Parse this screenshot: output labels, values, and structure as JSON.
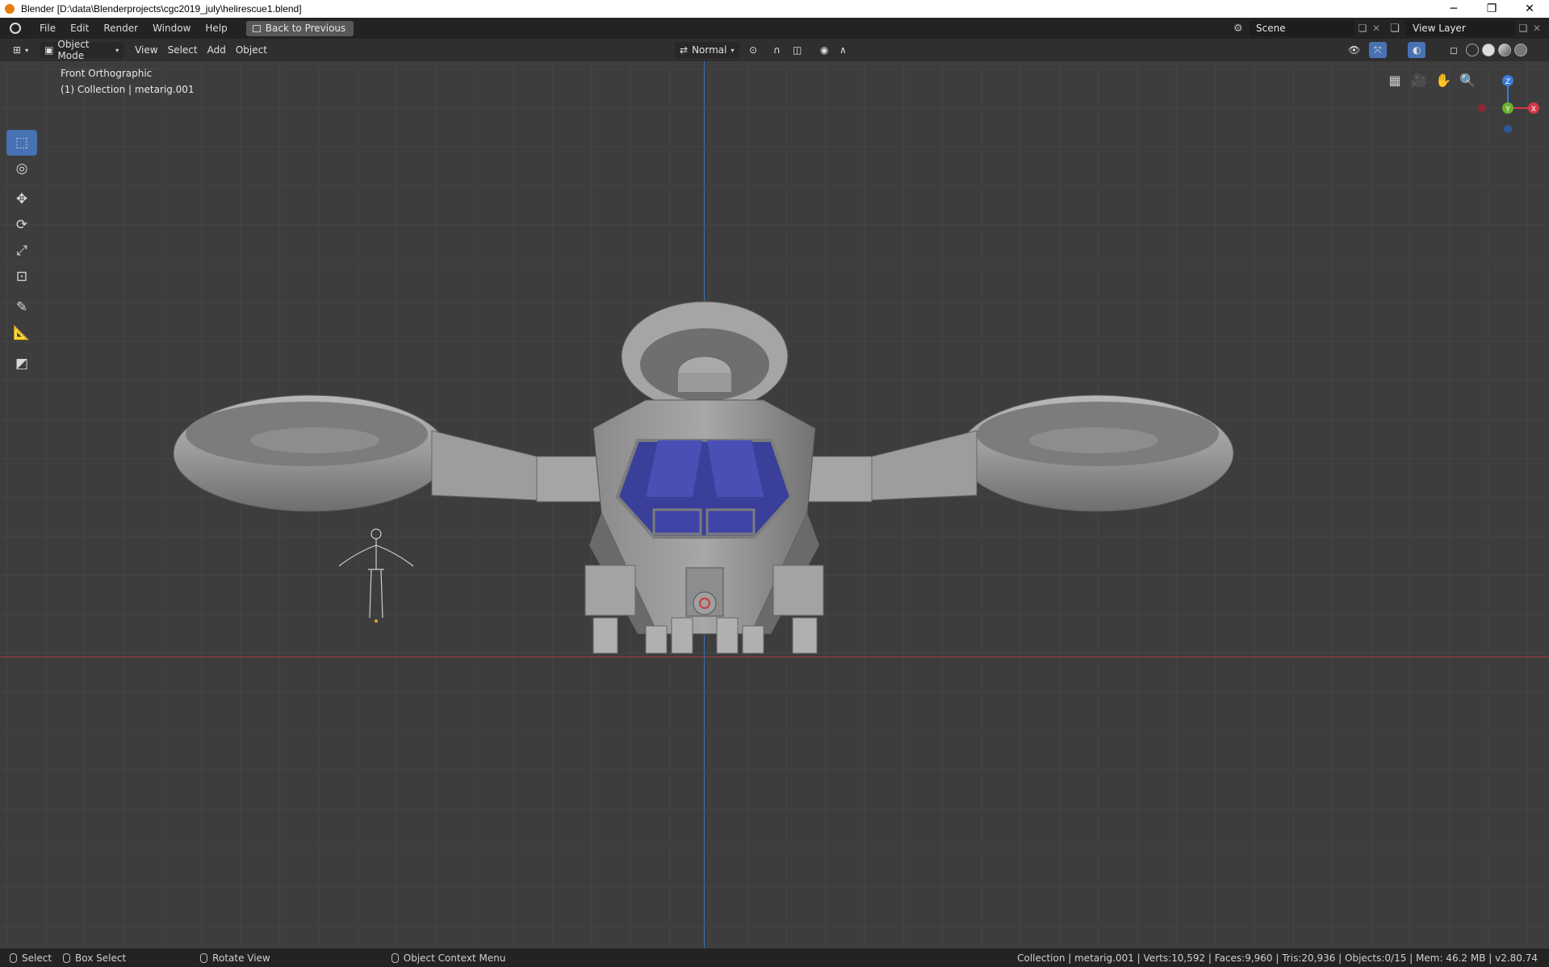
{
  "window": {
    "title": "Blender [D:\\data\\Blenderprojects\\cgc2019_july\\helirescue1.blend]",
    "minimize": "─",
    "restore": "❐",
    "close": "✕"
  },
  "menu": {
    "items": [
      "File",
      "Edit",
      "Render",
      "Window",
      "Help"
    ],
    "back_button": "Back to Previous"
  },
  "scene": {
    "scene_name": "Scene",
    "view_layer": "View Layer"
  },
  "viewport_header": {
    "mode": "Object Mode",
    "menus": [
      "View",
      "Select",
      "Add",
      "Object"
    ],
    "orientation": "Normal"
  },
  "viewport": {
    "view_name": "Front Orthographic",
    "collection_info": "(1) Collection | metarig.001",
    "gizmo": {
      "z": "Z",
      "y": "Y",
      "x": "X"
    }
  },
  "toolbar_icons": [
    "select-box-icon",
    "cursor-icon",
    "move-icon",
    "rotate-icon",
    "scale-icon",
    "transform-icon",
    "annotate-icon",
    "measure-icon",
    "add-cube-icon"
  ],
  "statusbar": {
    "select": "Select",
    "box_select": "Box Select",
    "rotate_view": "Rotate View",
    "context_menu": "Object Context Menu",
    "stats": "Collection | metarig.001 | Verts:10,592 | Faces:9,960 | Tris:20,936 | Objects:0/15 | Mem: 46.2 MB | v2.80.74"
  },
  "colors": {
    "accent": "#4772b3",
    "axis_x": "#a03a42",
    "axis_z": "#3a6fb0",
    "cockpit_glass": "#3a3f9a",
    "model_grey": "#9a9a9a"
  }
}
